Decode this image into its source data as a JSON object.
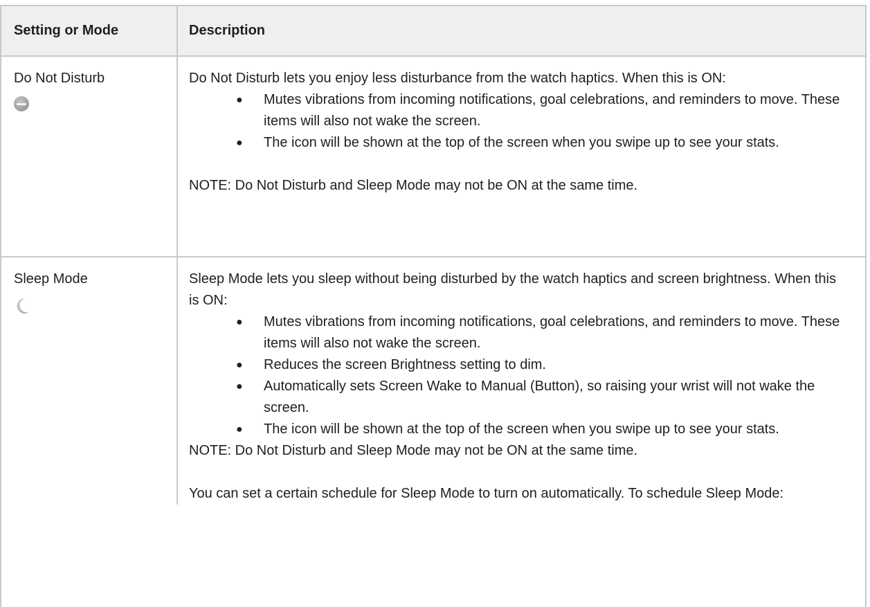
{
  "table": {
    "headers": [
      "Setting or Mode",
      "Description"
    ],
    "rows": [
      {
        "name": "Do Not Disturb",
        "icon": "do-not-disturb-icon",
        "intro": "Do Not Disturb lets you enjoy less disturbance from the watch haptics. When this is ON:",
        "bullets": [
          "Mutes vibrations from incoming notifications, goal celebrations, and reminders to move. These items will also not wake the screen.",
          "The icon will be shown at the top of the screen when you swipe up to see your stats."
        ],
        "note": "NOTE: Do Not Disturb and Sleep Mode may not be ON at the same time."
      },
      {
        "name": "Sleep Mode",
        "icon": "moon-icon",
        "intro": "Sleep Mode lets you sleep without being disturbed by the watch haptics and screen brightness. When this is ON:",
        "bullets": [
          "Mutes vibrations from incoming notifications, goal celebrations, and reminders to move. These items will also not wake the screen.",
          "Reduces the screen Brightness setting to dim.",
          "Automatically sets Screen Wake to Manual (Button), so raising your wrist will not wake the screen.",
          "The icon will be shown at the top of the screen when you swipe up to see your stats."
        ],
        "note": "NOTE: Do Not Disturb and Sleep Mode may not be ON at the same time.",
        "schedule": "You can set a certain schedule for Sleep Mode to turn on automatically. To schedule Sleep Mode:"
      }
    ],
    "bullet_glyph": "●"
  }
}
